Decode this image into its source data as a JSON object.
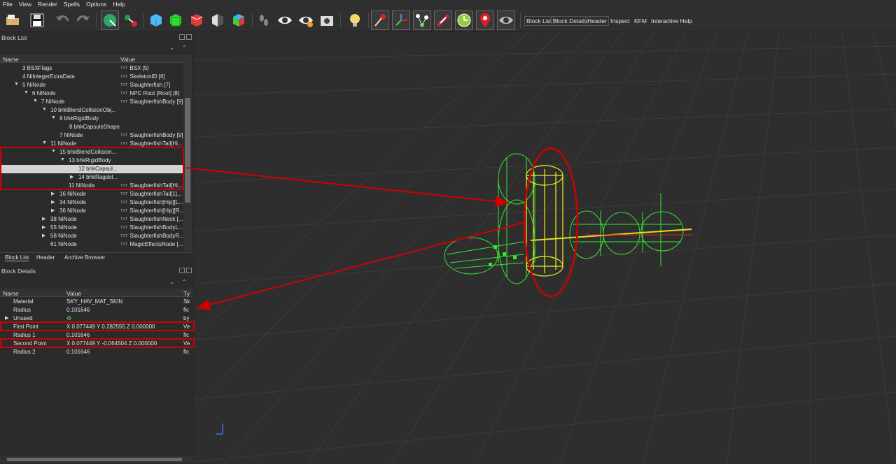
{
  "menu": [
    "File",
    "View",
    "Render",
    "Spells",
    "Options",
    "Help"
  ],
  "toolbar_tabs": [
    "Block List",
    "Block Details",
    "Header",
    "Inspect",
    "KFM",
    "Interactive Help"
  ],
  "block_list": {
    "title": "Block List",
    "col_name": "Name",
    "col_value": "Value",
    "rows": [
      {
        "name": "3 BSXFlags",
        "value": "BSX [5]"
      },
      {
        "name": "4 NiIntegerExtraData",
        "value": "SkeletonID [6]"
      },
      {
        "name": "5 NiNode",
        "value": "Slaughterfish [7]"
      },
      {
        "name": "6 NiNode",
        "value": "NPC Root [Root] [8]"
      },
      {
        "name": "7 NiNode",
        "value": "SlaughterfishBody [9]"
      },
      {
        "name": "10 bhkBlendCollisionObj...",
        "value": ""
      },
      {
        "name": "9 bhkRigidBody",
        "value": ""
      },
      {
        "name": "8 bhkCapsuleShape",
        "value": ""
      },
      {
        "name": "7 NiNode",
        "value": "SlaughterfishBody [9]"
      },
      {
        "name": "11 NiNode",
        "value": "SlaughterfishTail[Hi..."
      },
      {
        "name": "15 bhkBlendCollision...",
        "value": ""
      },
      {
        "name": "13 bhkRigidBody",
        "value": ""
      },
      {
        "name": "12 bhkCapsul...",
        "value": ""
      },
      {
        "name": "14 bhkRagdol...",
        "value": ""
      },
      {
        "name": "11 NiNode",
        "value": "SlaughterfishTail[Hi..."
      },
      {
        "name": "16 NiNode",
        "value": "SlaughterfishTail[1]..."
      },
      {
        "name": "34 NiNode",
        "value": "Slaughterfish[Hip][L..."
      },
      {
        "name": "36 NiNode",
        "value": "Slaughterfish[Hip][R..."
      },
      {
        "name": "38 NiNode",
        "value": "SlaughterfishNeck [..."
      },
      {
        "name": "55 NiNode",
        "value": "SlaughterfishBodyL..."
      },
      {
        "name": "58 NiNode",
        "value": "SlaughterfishBodyR..."
      },
      {
        "name": "61 NiNode",
        "value": "MagicEffectsNode [..."
      }
    ]
  },
  "bottom_tabs": [
    "Block List",
    "Header",
    "Archive Browser"
  ],
  "block_details": {
    "title": "Block Details",
    "col_name": "Name",
    "col_value": "Value",
    "col_type": "Ty",
    "rows": [
      {
        "name": "Material",
        "value": "SKY_HAV_MAT_SKIN",
        "type": "Sk"
      },
      {
        "name": "Radius",
        "value": "0.101646",
        "type": "flc"
      },
      {
        "name": "Unused",
        "value": "",
        "type": "by"
      },
      {
        "name": "First Point",
        "value": "X 0.077449 Y 0.282555 Z 0.000000",
        "type": "Ve"
      },
      {
        "name": "Radius 1",
        "value": "0.101646",
        "type": "flc"
      },
      {
        "name": "Second Point",
        "value": "X 0.077449 Y -0.064504 Z 0.000000",
        "type": "Ve"
      },
      {
        "name": "Radius 2",
        "value": "0.101646",
        "type": "flc"
      }
    ]
  },
  "colors": {
    "highlight": "#d00000",
    "wire_green": "#33e833",
    "wire_yellow": "#f0f020"
  },
  "icons": [
    "open-folder-icon",
    "save-icon",
    "undo-icon",
    "redo-icon",
    "select-object-icon",
    "connect-icon",
    "cube-blue-icon",
    "cube-green-icon",
    "cube-red-icon",
    "half-shade-icon",
    "cube-color-icon",
    "footprint-icon",
    "eye-icon",
    "eye-alt-icon",
    "camera-icon",
    "bulb-icon",
    "pin-icon",
    "axes-icon",
    "nodes-icon",
    "stripe-icon",
    "clock-icon",
    "marker-icon",
    "eye-hide-icon"
  ]
}
